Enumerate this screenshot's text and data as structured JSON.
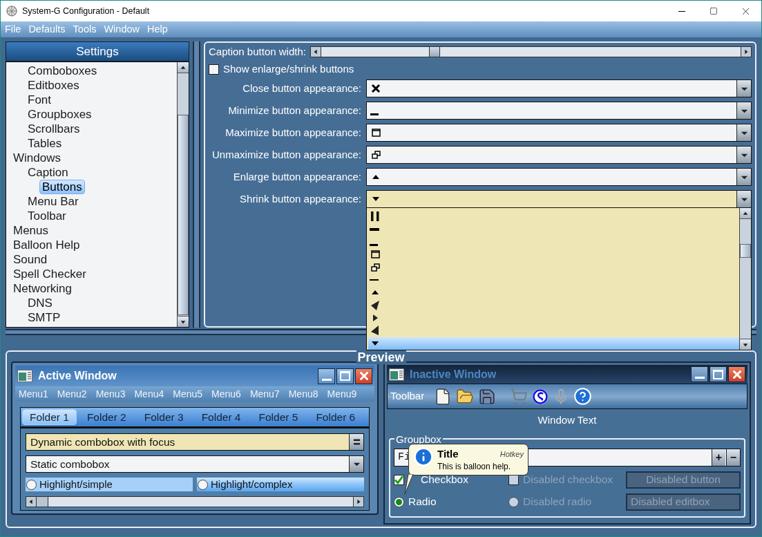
{
  "window": {
    "title": "System-G Configuration - Default"
  },
  "menu_bar": [
    "File",
    "Defaults",
    "Tools",
    "Window",
    "Help"
  ],
  "settings": {
    "title": "Settings",
    "tree": [
      {
        "children": [
          {
            "label": "Comboboxes",
            "selected": false
          },
          {
            "label": "Editboxes",
            "selected": false
          },
          {
            "label": "Font",
            "selected": false
          },
          {
            "label": "Groupboxes",
            "selected": false
          },
          {
            "label": "Scrollbars",
            "selected": false
          },
          {
            "label": "Tables",
            "selected": false
          }
        ]
      },
      {
        "label": "Windows",
        "selected": false,
        "children": [
          {
            "label": "Caption",
            "selected": false,
            "children": [
              {
                "label": "Buttons",
                "selected": true
              }
            ]
          },
          {
            "label": "Menu Bar",
            "selected": false
          },
          {
            "label": "Toolbar",
            "selected": false
          }
        ]
      },
      {
        "label": "Menus",
        "selected": false
      },
      {
        "label": "Balloon Help",
        "selected": false
      },
      {
        "label": "Sound",
        "selected": false
      },
      {
        "label": "Spell Checker",
        "selected": false
      },
      {
        "label": "Networking",
        "selected": false,
        "children": [
          {
            "label": "DNS",
            "selected": false
          },
          {
            "label": "SMTP",
            "selected": false
          }
        ]
      }
    ]
  },
  "caption_buttons": {
    "width_label": "Caption button width:",
    "width_slider": {
      "level": 0.27
    },
    "show_enlarge_shrink": {
      "label": "Show enlarge/shrink buttons",
      "checked": false
    },
    "appearances": [
      {
        "label": "Close button appearance:",
        "kind": "cross",
        "focused": false
      },
      {
        "label": "Minimize button appearance:",
        "kind": "bar",
        "focused": false
      },
      {
        "label": "Maximize button appearance:",
        "kind": "window",
        "focused": false
      },
      {
        "label": "Unmaximize button appearance:",
        "kind": "restore",
        "focused": false
      },
      {
        "label": "Enlarge button appearance:",
        "kind": "up",
        "focused": false
      },
      {
        "label": "Shrink button appearance:",
        "kind": "down",
        "focused": true
      }
    ],
    "dropdown_options": [
      {
        "kind": "pause",
        "selected": false
      },
      {
        "kind": "thick-bar",
        "selected": false
      },
      {
        "kind": "bar",
        "selected": false
      },
      {
        "kind": "window",
        "selected": false
      },
      {
        "kind": "restore",
        "selected": false
      },
      {
        "kind": "dash",
        "selected": false
      },
      {
        "kind": "up",
        "selected": false
      },
      {
        "kind": "big-left",
        "selected": false
      },
      {
        "kind": "right",
        "selected": false
      },
      {
        "kind": "left",
        "selected": false
      },
      {
        "kind": "down",
        "selected": true
      }
    ]
  },
  "preview": {
    "title": "Preview",
    "active_window": {
      "title": "Active Window",
      "active": true,
      "menus": [
        "Menu1",
        "Menu2",
        "Menu3",
        "Menu4",
        "Menu5",
        "Menu6",
        "Menu7",
        "Menu8",
        "Menu9"
      ],
      "tabs": [
        {
          "label": "Folder 1",
          "selected": true
        },
        {
          "label": "Folder 2",
          "selected": false
        },
        {
          "label": "Folder 3",
          "selected": false
        },
        {
          "label": "Folder 4",
          "selected": false
        },
        {
          "label": "Folder 5",
          "selected": false
        },
        {
          "label": "Folder 6",
          "selected": false
        }
      ],
      "dynamic_combo": {
        "value": "Dynamic combobox with focus",
        "focused": true
      },
      "static_combo": {
        "value": "Static combobox",
        "focused": false
      },
      "highlights": [
        {
          "label": "Highlight/simple",
          "kind": "simple",
          "selected": false
        },
        {
          "label": "Highlight/complex",
          "kind": "complex",
          "selected": false
        }
      ]
    },
    "inactive_window": {
      "title": "Inactive Window",
      "active": false,
      "toolbar_label": "Toolbar",
      "window_text": "Window Text",
      "groupbox": {
        "title": "Groupbox",
        "spin_field": {
          "value": "Fi",
          "plus": "+",
          "minus": "−"
        },
        "checkbox": {
          "label": "Checkbox",
          "checked": true,
          "disabled": false
        },
        "disabled_checkbox": {
          "label": "Disabled checkbox",
          "checked": false,
          "disabled": true
        },
        "disabled_button": {
          "label": "Disabled button",
          "disabled": true
        },
        "radio": {
          "label": "Radio",
          "selected": true,
          "disabled": false
        },
        "disabled_radio": {
          "label": "Disabled radio",
          "selected": false,
          "disabled": true
        },
        "disabled_editbox": {
          "value": "Disabled editbox",
          "disabled": true
        }
      },
      "balloon": {
        "title": "Title",
        "hotkey": "Hotkey",
        "text": "This is balloon help."
      }
    }
  }
}
